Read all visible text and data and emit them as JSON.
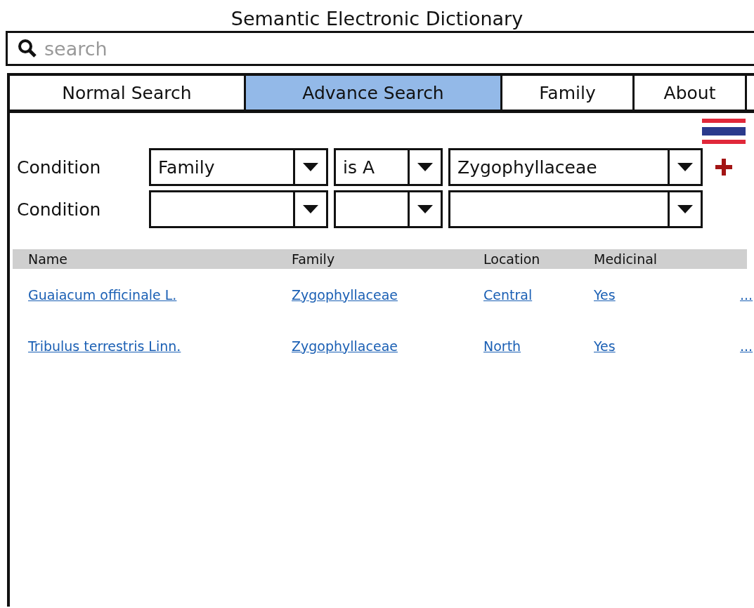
{
  "window": {
    "title": "Semantic Electronic Dictionary"
  },
  "search": {
    "placeholder": "search"
  },
  "tabs": [
    {
      "label": "Normal Search",
      "selected": false
    },
    {
      "label": "Advance Search",
      "selected": true
    },
    {
      "label": "Family",
      "selected": false
    },
    {
      "label": "About",
      "selected": false
    }
  ],
  "conditions": [
    {
      "label": "Condition",
      "field": "Family",
      "operator": "is A",
      "value": "Zygophyllaceae",
      "add_button": true
    },
    {
      "label": "Condition",
      "add_button": false
    }
  ],
  "table": {
    "columns": [
      "Name",
      "Family",
      "Location",
      "Medicinal"
    ],
    "rows": [
      {
        "cells": [
          "Guaiacum officinale L.",
          "Zygophyllaceae",
          "Central",
          "Yes"
        ],
        "more": "..."
      },
      {
        "cells": [
          "Tribulus terrestris Linn.",
          "Zygophyllaceae",
          "North",
          "Yes"
        ],
        "more": "..."
      }
    ]
  }
}
